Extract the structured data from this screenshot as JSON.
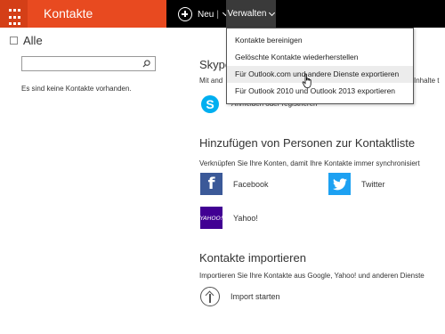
{
  "app": {
    "title": "Kontakte"
  },
  "toolbar": {
    "new_label": "Neu",
    "separator": "|",
    "manage_label": "Verwalten"
  },
  "manage_menu": {
    "items": [
      {
        "label": "Kontakte bereinigen"
      },
      {
        "label": "Gelöschte Kontakte wiederherstellen"
      },
      {
        "label": "Für Outlook.com und andere Dienste exportieren"
      },
      {
        "label": "Für Outlook 2010 und Outlook 2013 exportieren"
      }
    ]
  },
  "sidebar": {
    "all_label": "Alle",
    "search_placeholder": "",
    "empty_message": "Es sind keine Kontakte vorhanden."
  },
  "skype": {
    "heading": "Skype",
    "subtext": "Mit and",
    "subtext_tail": "Inhalte t",
    "link": "Anmelden oder registrieren"
  },
  "add_people": {
    "heading": "Hinzufügen von Personen zur Kontaktliste",
    "subtext": "Verknüpfen Sie Ihre Konten, damit Ihre Kontakte immer synchronisiert",
    "services": [
      {
        "label": "Facebook"
      },
      {
        "label": "Twitter"
      },
      {
        "label": "Yahoo!"
      }
    ],
    "yahoo_logo_text": "YAHOO!"
  },
  "import": {
    "heading": "Kontakte importieren",
    "subtext": "Importieren Sie Ihre Kontakte aus Google, Yahoo! und anderen Dienste",
    "button_label": "Import starten"
  },
  "colors": {
    "brand": "#e84a20",
    "topbar": "#000000",
    "facebook": "#3b5998",
    "twitter": "#1da1f2",
    "yahoo": "#410093",
    "skype": "#00aff0"
  }
}
